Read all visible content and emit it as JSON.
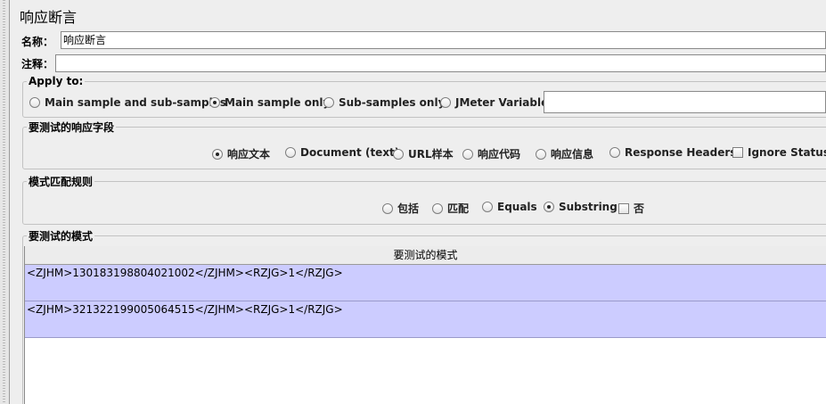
{
  "title": "响应断言",
  "name": {
    "label": "名称：",
    "value": "响应断言"
  },
  "comment": {
    "label": "注释：",
    "value": ""
  },
  "apply_to": {
    "legend": "Apply to:",
    "options": [
      "Main sample and sub-samples",
      "Main sample only",
      "Sub-samples only",
      "JMeter Variable"
    ],
    "selected": "Main sample only",
    "variable_value": ""
  },
  "response_field": {
    "legend": "要测试的响应字段",
    "options": [
      "响应文本",
      "Document (text)",
      "URL样本",
      "响应代码",
      "响应信息",
      "Response Headers"
    ],
    "selected": "响应文本",
    "ignore_status_label": "Ignore Status",
    "ignore_status_checked": false
  },
  "pattern_rules": {
    "legend": "模式匹配规则",
    "options": [
      "包括",
      "匹配",
      "Equals",
      "Substring"
    ],
    "selected": "Substring",
    "not_label": "否",
    "not_checked": false
  },
  "patterns": {
    "legend": "要测试的模式",
    "column_header": "要测试的模式",
    "rows": [
      "<ZJHM>130183198804021002</ZJHM><RZJG>1</RZJG>",
      "<ZJHM>321322199005064515</ZJHM><RZJG>1</RZJG>"
    ]
  }
}
